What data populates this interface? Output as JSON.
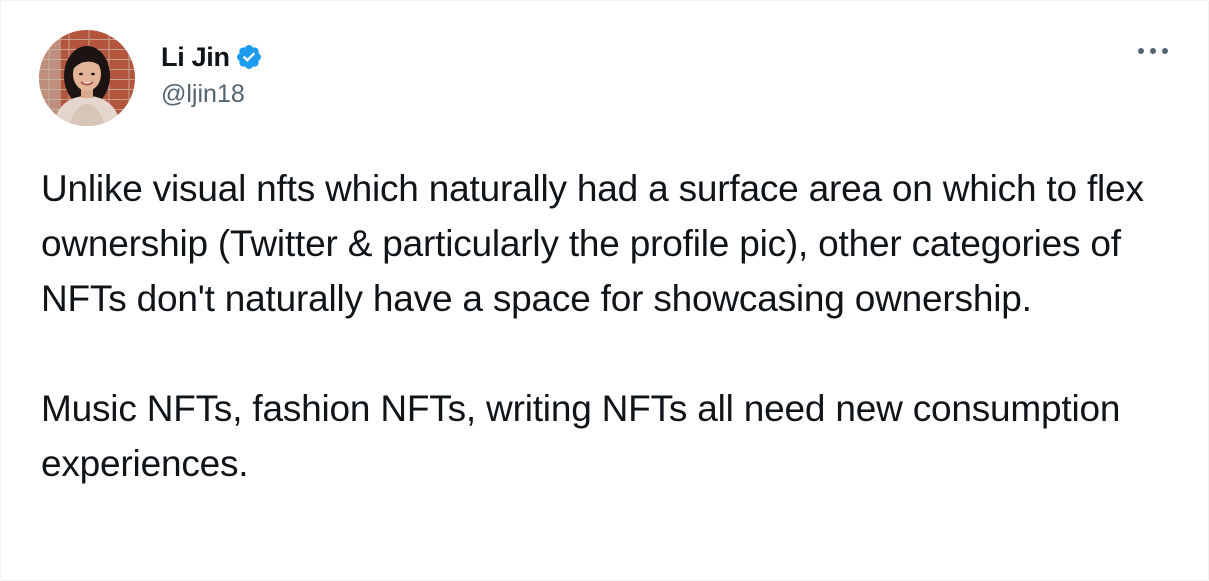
{
  "tweet": {
    "author": {
      "display_name": "Li Jin",
      "handle": "@ljin18",
      "verified": true,
      "verified_icon": "verified-badge-icon",
      "avatar_icon": "profile-photo"
    },
    "more_icon": "more-horizontal-icon",
    "paragraphs": [
      "Unlike visual nfts which naturally had a surface area on which to flex ownership (Twitter & particularly the profile pic), other categories of NFTs don't naturally have a space for showcasing ownership.",
      "Music NFTs, fashion NFTs, writing NFTs all need new consumption experiences."
    ]
  },
  "colors": {
    "text_primary": "#0f1419",
    "text_secondary": "#536471",
    "verified_blue": "#1d9bf0",
    "background": "#ffffff"
  }
}
